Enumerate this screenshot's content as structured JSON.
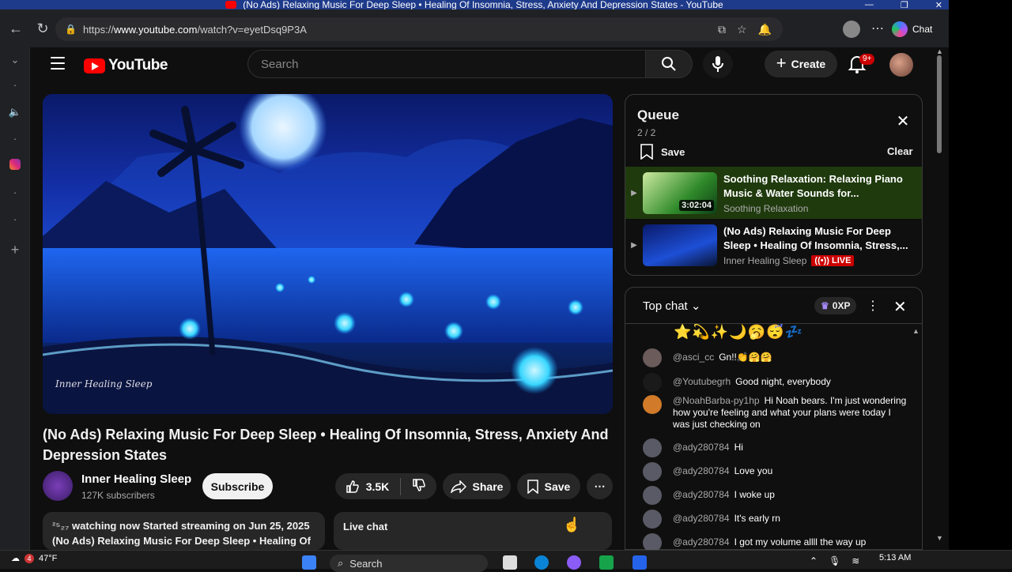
{
  "window": {
    "title": "(No Ads) Relaxing Music For Deep Sleep • Healing Of Insomnia, Stress, Anxiety And Depression States - YouTube"
  },
  "browser": {
    "url_prefix": "https://",
    "url_domain": "www.youtube.com",
    "url_path": "/watch?v=eyetDsq9P3A",
    "chat_label": "Chat"
  },
  "youtube": {
    "logo_text": "YouTube",
    "search_placeholder": "Search",
    "create_label": "Create",
    "notifications_badge": "9+"
  },
  "video": {
    "title": "(No Ads) Relaxing Music For Deep Sleep • Healing Of Insomnia, Stress, Anxiety And Depression States",
    "watermark": "Inner Healing Sleep",
    "channel_name": "Inner Healing Sleep",
    "subscribers": "127K subscribers",
    "subscribe_label": "Subscribe",
    "likes": "3.5K",
    "share_label": "Share",
    "save_label": "Save",
    "description_line1": "watching now  Started streaming on Jun 25, 2025",
    "description_line2": "(No Ads) Relaxing Music For Deep Sleep • Healing Of",
    "live_chat_label": "Live chat"
  },
  "queue": {
    "title": "Queue",
    "count": "2 / 2",
    "save_label": "Save",
    "clear_label": "Clear",
    "items": [
      {
        "title": "Soothing Relaxation: Relaxing Piano Music & Water Sounds for...",
        "channel": "Soothing Relaxation",
        "duration": "3:02:04",
        "active": true
      },
      {
        "title": "(No Ads) Relaxing Music For Deep Sleep • Healing Of Insomnia, Stress,...",
        "channel": "Inner Healing Sleep",
        "badge": "LIVE"
      }
    ]
  },
  "chat": {
    "header": "Top chat",
    "xp": "0XP",
    "emoji_line": "⭐💫✨🌙🥱😴💤",
    "messages": [
      {
        "author": "@asci_cc",
        "text": "Gn!!👏🤗🤗"
      },
      {
        "author": "@Youtubegrh",
        "text": "Good night, everybody"
      },
      {
        "author": "@NoahBarba-py1hp",
        "text": "Hi Noah bears. I'm just wondering how you're feeling and what your plans were today I was just checking on"
      },
      {
        "author": "@ady280784",
        "text": "Hi"
      },
      {
        "author": "@ady280784",
        "text": "Love you"
      },
      {
        "author": "@ady280784",
        "text": "I woke up"
      },
      {
        "author": "@ady280784",
        "text": "It's early rn"
      },
      {
        "author": "@ady280784",
        "text": "I got my volume allll the way up"
      }
    ]
  },
  "taskbar": {
    "temperature": "47°F",
    "search_label": "Search",
    "time": "5:13 AM",
    "weather_badge": "4"
  },
  "colors": {
    "accent_red": "#ff0000",
    "live_red": "#cc0000",
    "active_queue_row": "#1f3a0d"
  }
}
